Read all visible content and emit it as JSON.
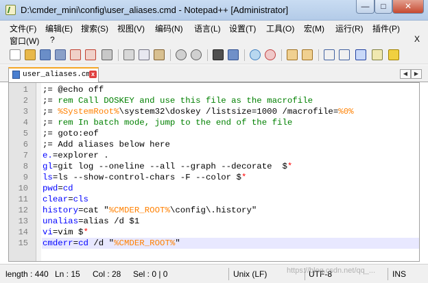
{
  "window": {
    "title": "D:\\cmder_mini\\config\\user_aliases.cmd - Notepad++ [Administrator]",
    "minimize_glyph": "—",
    "maximize_glyph": "□",
    "close_glyph": "✕"
  },
  "menu": {
    "items": [
      "文件(F)",
      "编辑(E)",
      "搜索(S)",
      "视图(V)",
      "编码(N)",
      "语言(L)",
      "设置(T)",
      "工具(O)",
      "宏(M)",
      "运行(R)",
      "插件(P)",
      "窗口(W)",
      "?"
    ],
    "close_doc_glyph": "X"
  },
  "toolbar": {
    "icons": [
      "new-file-icon",
      "open-file-icon",
      "save-icon",
      "save-all-icon",
      "close-icon",
      "close-all-icon",
      "print-icon",
      "cut-icon",
      "copy-icon",
      "paste-icon",
      "undo-icon",
      "redo-icon",
      "find-icon",
      "replace-icon",
      "zoom-in-icon",
      "zoom-out-icon",
      "sync-vertical-icon",
      "sync-horizontal-icon",
      "word-wrap-icon",
      "show-all-chars-icon",
      "indent-guide-icon",
      "doc-map-icon",
      "function-list-icon"
    ]
  },
  "tab": {
    "label": "user_aliases.cmd",
    "close_glyph": "x",
    "left_arrow": "◀",
    "right_arrow": "▶"
  },
  "editor": {
    "current_line": 15,
    "lines": [
      {
        "n": "1",
        "t": [
          [
            ";= ",
            "plain"
          ],
          [
            "@echo off",
            "plain"
          ]
        ]
      },
      {
        "n": "2",
        "t": [
          [
            ";= ",
            "plain"
          ],
          [
            "rem Call DOSKEY and use this file as the macrofile",
            "cmt"
          ]
        ]
      },
      {
        "n": "3",
        "t": [
          [
            ";= ",
            "plain"
          ],
          [
            "%SystemRoot%",
            "var"
          ],
          [
            "\\system32\\doskey /listsize=1000 /macrofile=",
            "plain"
          ],
          [
            "%0%",
            "var"
          ]
        ]
      },
      {
        "n": "4",
        "t": [
          [
            ";= ",
            "plain"
          ],
          [
            "rem In batch mode, jump to the end of the file",
            "cmt"
          ]
        ]
      },
      {
        "n": "5",
        "t": [
          [
            ";= ",
            "plain"
          ],
          [
            "goto:eof",
            "plain"
          ]
        ]
      },
      {
        "n": "6",
        "t": [
          [
            ";= ",
            "plain"
          ],
          [
            "Add aliases below here",
            "plain"
          ]
        ]
      },
      {
        "n": "7",
        "t": [
          [
            "e.",
            "key"
          ],
          [
            "=explorer .",
            "plain"
          ]
        ]
      },
      {
        "n": "8",
        "t": [
          [
            "gl",
            "key"
          ],
          [
            "=git log --oneline --all --graph --decorate  $",
            "plain"
          ],
          [
            "*",
            "op"
          ]
        ]
      },
      {
        "n": "9",
        "t": [
          [
            "ls",
            "key"
          ],
          [
            "=ls --show-control-chars -F --color $",
            "plain"
          ],
          [
            "*",
            "op"
          ]
        ]
      },
      {
        "n": "10",
        "t": [
          [
            "pwd",
            "key"
          ],
          [
            "=",
            "plain"
          ],
          [
            "cd",
            "key"
          ]
        ]
      },
      {
        "n": "11",
        "t": [
          [
            "clear",
            "key"
          ],
          [
            "=",
            "plain"
          ],
          [
            "cls",
            "key"
          ]
        ]
      },
      {
        "n": "12",
        "t": [
          [
            "history",
            "key"
          ],
          [
            "=cat \"",
            "plain"
          ],
          [
            "%CMDER_ROOT%",
            "var"
          ],
          [
            "\\config\\.history\"",
            "plain"
          ]
        ]
      },
      {
        "n": "13",
        "t": [
          [
            "unalias",
            "key"
          ],
          [
            "=alias /d $1",
            "plain"
          ]
        ]
      },
      {
        "n": "14",
        "t": [
          [
            "vi",
            "key"
          ],
          [
            "=vim $",
            "plain"
          ],
          [
            "*",
            "op"
          ]
        ]
      },
      {
        "n": "15",
        "t": [
          [
            "cmderr",
            "key"
          ],
          [
            "=",
            "plain"
          ],
          [
            "cd",
            "key"
          ],
          [
            " /d \"",
            "plain"
          ],
          [
            "%CMDER_ROOT%",
            "var"
          ],
          [
            "\"",
            "plain"
          ]
        ]
      }
    ]
  },
  "status": {
    "length": "length : 440",
    "ln": "Ln : 15",
    "col": "Col : 28",
    "sel": "Sel : 0 | 0",
    "eol": "Unix (LF)",
    "encoding": "UTF-8",
    "mode": "INS"
  },
  "watermark": "https://blog.csdn.net/qq_..."
}
